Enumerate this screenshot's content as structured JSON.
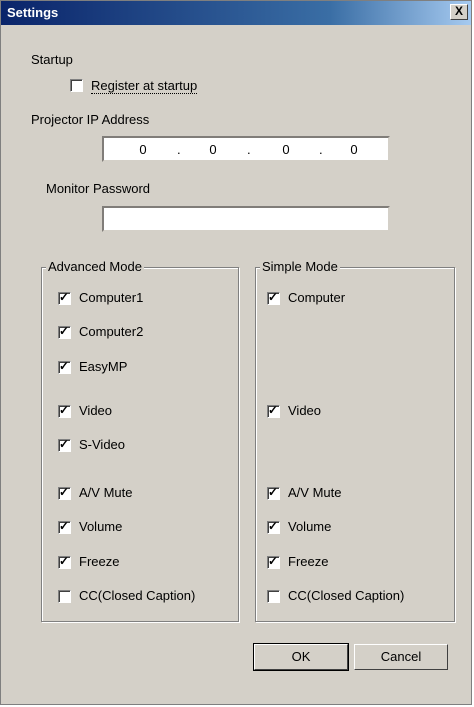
{
  "window": {
    "title": "Settings",
    "close_label": "X"
  },
  "startup": {
    "label": "Startup",
    "register_label": "Register at startup",
    "register_checked": false
  },
  "ip": {
    "label": "Projector IP Address",
    "octets": [
      "0",
      "0",
      "0",
      "0"
    ],
    "separator": "."
  },
  "password": {
    "label": "Monitor Password",
    "value": ""
  },
  "advanced": {
    "title": "Advanced Mode",
    "items": [
      {
        "label": "Computer1",
        "checked": true
      },
      {
        "label": "Computer2",
        "checked": true
      },
      {
        "label": "EasyMP",
        "checked": true
      },
      {
        "label": "Video",
        "checked": true
      },
      {
        "label": "S-Video",
        "checked": true
      },
      {
        "label": "A/V Mute",
        "checked": true
      },
      {
        "label": "Volume",
        "checked": true
      },
      {
        "label": "Freeze",
        "checked": true
      },
      {
        "label": "CC(Closed Caption)",
        "checked": false
      }
    ]
  },
  "simple": {
    "title": "Simple Mode",
    "items": [
      {
        "label": "Computer",
        "checked": true
      },
      {
        "label": "Video",
        "checked": true
      },
      {
        "label": "A/V Mute",
        "checked": true
      },
      {
        "label": "Volume",
        "checked": true
      },
      {
        "label": "Freeze",
        "checked": true
      },
      {
        "label": "CC(Closed Caption)",
        "checked": false
      }
    ]
  },
  "buttons": {
    "ok": "OK",
    "cancel": "Cancel"
  }
}
